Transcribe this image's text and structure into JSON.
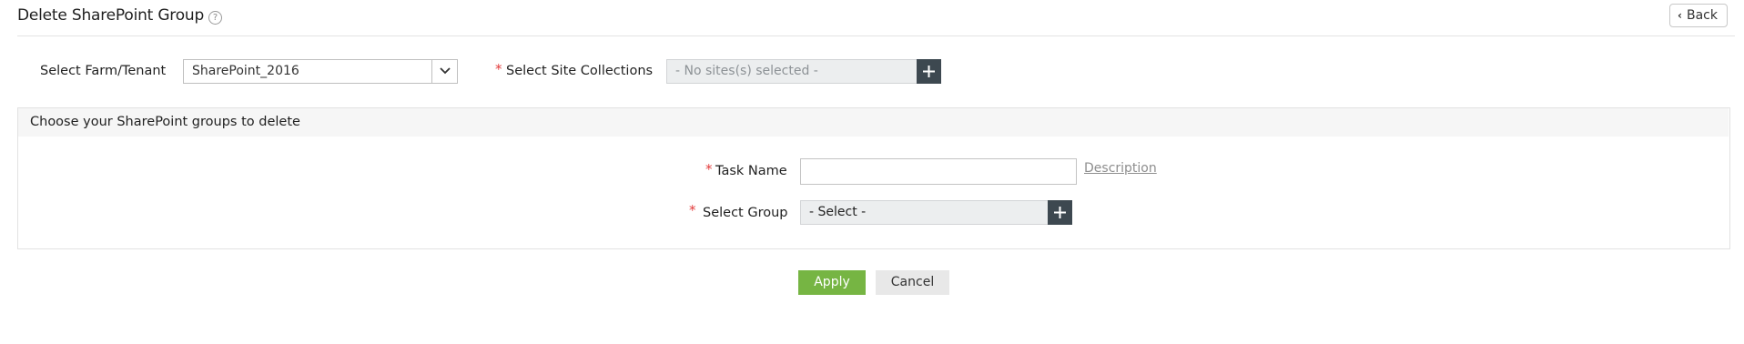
{
  "header": {
    "title": "Delete SharePoint Group",
    "help_glyph": "?",
    "back_label": "Back"
  },
  "filters": {
    "farm_label": "Select Farm/Tenant",
    "farm_value": "SharePoint_2016",
    "sites_label": "Select Site Collections",
    "sites_placeholder": "- No sites(s) selected -"
  },
  "panel": {
    "title": "Choose your SharePoint groups to delete",
    "task_name_label": "Task Name",
    "task_name_value": "",
    "description_link": "Description",
    "select_group_label": "Select Group",
    "select_group_value": "- Select -"
  },
  "actions": {
    "apply_label": "Apply",
    "cancel_label": "Cancel"
  },
  "colors": {
    "accent_green": "#76b543",
    "plus_button": "#3d4850",
    "required_mark": "#e23b3b"
  }
}
